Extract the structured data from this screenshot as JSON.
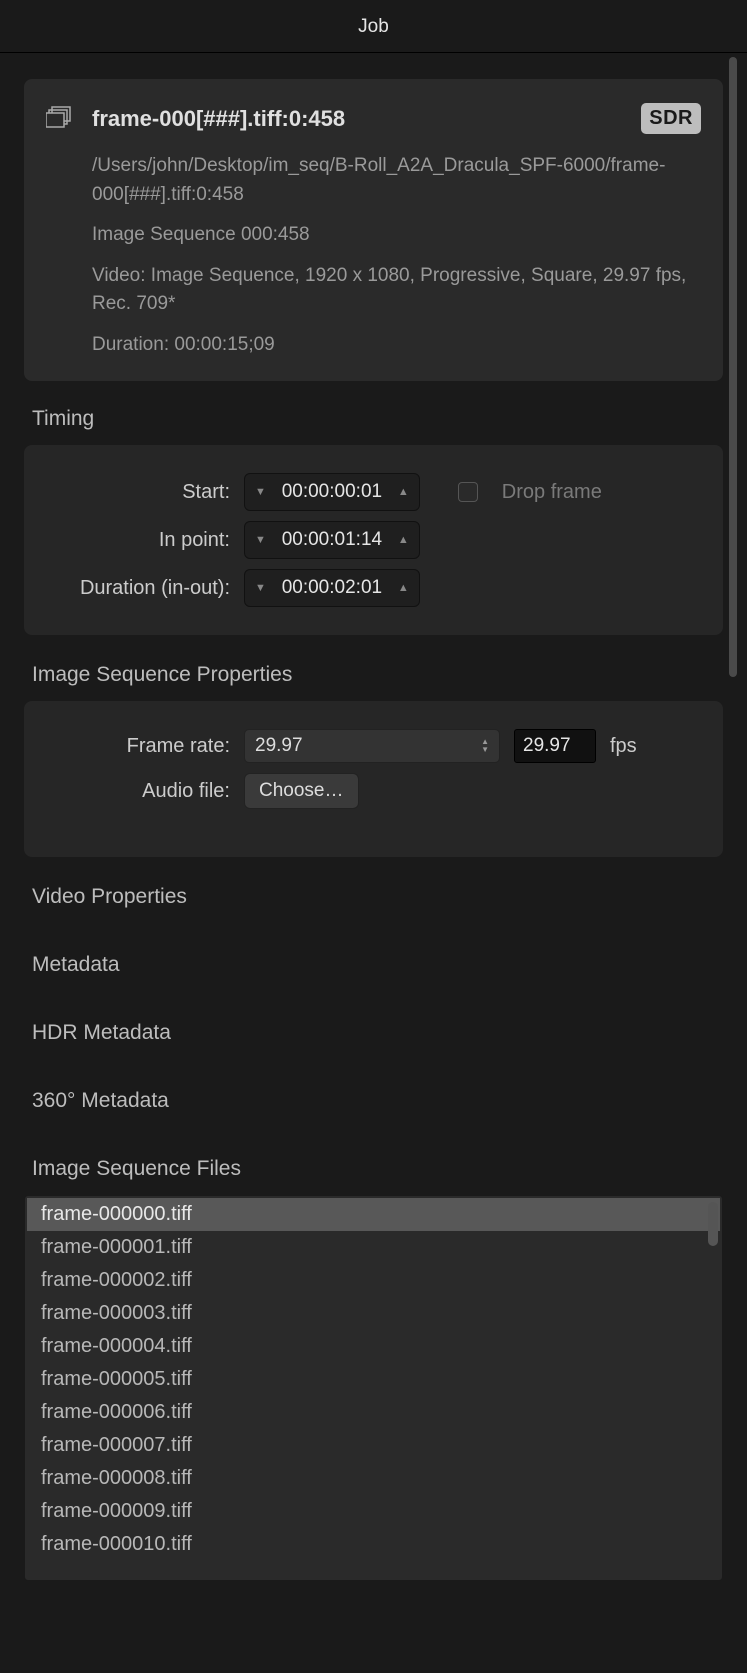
{
  "window": {
    "title": "Job"
  },
  "info": {
    "filename": "frame-000[###].tiff:0:458",
    "badge": "SDR",
    "path": "/Users/john/Desktop/im_seq/B-Roll_A2A_Dracula_SPF-6000/frame-000[###].tiff:0:458",
    "sequence": "Image Sequence 000:458",
    "video": "Video: Image Sequence, 1920 x 1080, Progressive, Square, 29.97 fps, Rec. 709*",
    "duration": "Duration: 00:00:15;09"
  },
  "sections": {
    "timing": "Timing",
    "img_seq_props": "Image Sequence Properties",
    "video_props": "Video Properties",
    "metadata": "Metadata",
    "hdr_metadata": "HDR Metadata",
    "metadata_360": "360° Metadata",
    "img_seq_files": "Image Sequence Files"
  },
  "timing": {
    "start_label": "Start:",
    "start_value": "00:00:00:01",
    "drop_frame_label": "Drop frame",
    "drop_frame_checked": false,
    "in_point_label": "In point:",
    "in_point_value": "00:00:01:14",
    "duration_label": "Duration (in-out):",
    "duration_value": "00:00:02:01"
  },
  "img_seq_props": {
    "frame_rate_label": "Frame rate:",
    "frame_rate_select": "29.97",
    "frame_rate_input": "29.97",
    "fps_unit": "fps",
    "audio_file_label": "Audio file:",
    "choose_button": "Choose…"
  },
  "files": [
    "frame-000000.tiff",
    "frame-000001.tiff",
    "frame-000002.tiff",
    "frame-000003.tiff",
    "frame-000004.tiff",
    "frame-000005.tiff",
    "frame-000006.tiff",
    "frame-000007.tiff",
    "frame-000008.tiff",
    "frame-000009.tiff",
    "frame-000010.tiff"
  ]
}
